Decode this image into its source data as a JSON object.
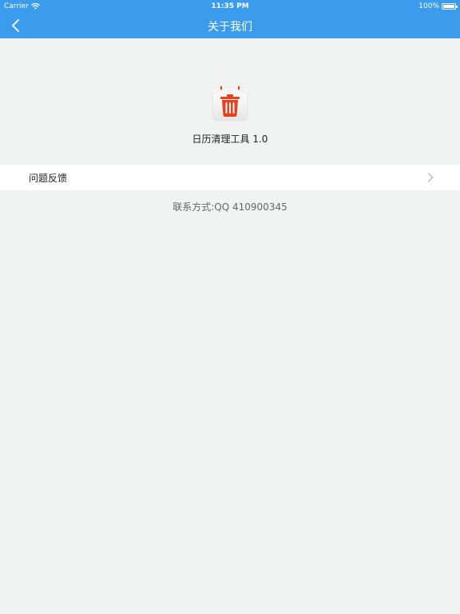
{
  "status_bar": {
    "carrier": "Carrier",
    "time": "11:35 PM",
    "battery": "100%",
    "icons": [
      "wifi-icon",
      "battery-icon"
    ]
  },
  "nav": {
    "title": "关于我们",
    "back_icon": "chevron-left-icon"
  },
  "app": {
    "icon": "trash-can-icon",
    "name": "日历清理工具 1.0"
  },
  "menu": {
    "feedback_label": "问题反馈",
    "chevron_icon": "chevron-right-icon"
  },
  "contact": "联系方式:QQ 410900345",
  "colors": {
    "nav_background": "#3b9ced",
    "page_background": "#f0f3f2",
    "icon_accent": "#e8401c"
  }
}
